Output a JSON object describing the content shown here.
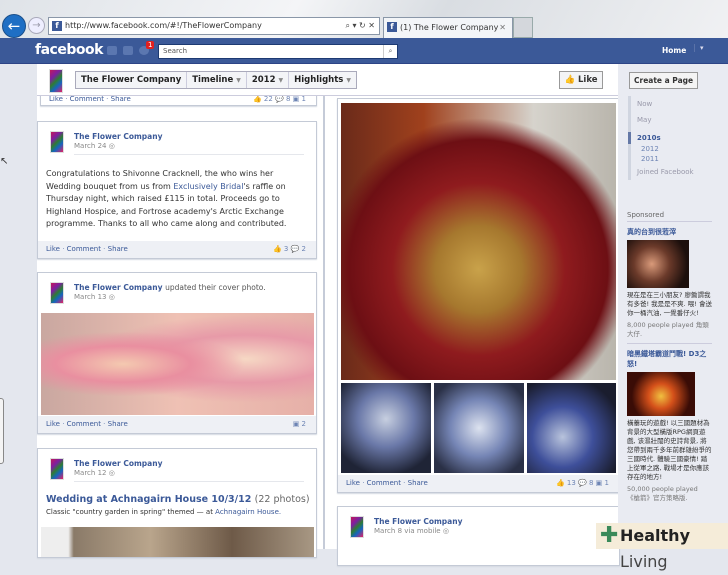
{
  "browser": {
    "url": "http://www.facebook.com/#!/TheFlowerCompany",
    "tab_title": "(1) The Flower Company",
    "addr_tools": "⌕ ▾ ↻ ✕",
    "tab_close": "✕",
    "back": "←",
    "forward": "→"
  },
  "fb": {
    "logo": "facebook",
    "notification_count": "1",
    "search_placeholder": "Search",
    "home": "Home",
    "home_dropdown": "▾"
  },
  "header": {
    "page_name": "The Flower Company",
    "timeline": "Timeline",
    "year": "2012",
    "highlights": "Highlights",
    "like_button": "Like"
  },
  "actions": {
    "like": "Like",
    "comment": "Comment",
    "share": "Share",
    "sep": " · "
  },
  "posts": [
    {
      "counts": {
        "likes": "22",
        "comments": "8",
        "shares": "1"
      }
    },
    {
      "name": "The Flower Company",
      "date": "March 24",
      "text_before": "Congratulations to Shivonne Cracknell, the who wins her Wedding bouquet from us from ",
      "link": "Exclusively Bridal",
      "text_after": "'s raffle on Thursday night, which raised £115 in total. Proceeds go to Highland Hospice, and Fortrose academy's Arctic Exchange programme. Thanks to all who came along and contributed.",
      "counts": {
        "likes": "3",
        "comments": "2"
      }
    },
    {
      "name": "The Flower Company",
      "action": "updated their cover photo.",
      "date": "March 13",
      "counts": {
        "shares": "2"
      }
    },
    {
      "name": "The Flower Company",
      "date": "March 12",
      "album_title": "Wedding at Achnagairn House 10/3/12",
      "photo_count": "(22 photos)",
      "caption": "Classic \"country garden in spring\" themed — at ",
      "location": "Achnagairn House."
    },
    {
      "counts": {
        "likes": "13",
        "comments": "8",
        "shares": "1"
      }
    },
    {
      "name": "The Flower Company",
      "date": "March 8 via mobile"
    }
  ],
  "sidebar": {
    "create_page": "Create a Page",
    "scrubber": [
      "Now",
      "May",
      "2010s",
      "2012",
      "2011",
      "Joined Facebook"
    ],
    "sponsored": "Sponsored",
    "ads": [
      {
        "title": "真的台到很蒞滓",
        "text": "現在是在三小朋友? 廖鋤謂我有多爸! 我是是不爽. 喂! 會送你一桶汽油, 一覺番仔火!",
        "meta": "8,000 people played 角頭大仔."
      },
      {
        "title": "暗黑鐵塔霸道鬥戰! D3之怒!",
        "text": "橫蓁玩的遊戲! 以三國題材為背景的大型橫版RPG網頁遊戲, 该濕壯闊的史詩背景, 將您帶到兩千多年前群雄紛爭的三國時代. 體驗三國豪情! 踏上從軍之路, 戰場才是你應該存在的地方!",
        "meta": "50,000 people played 《槍箭》官方策略版."
      }
    ]
  },
  "watermark": {
    "brand_bold": "Healthy",
    "brand_light": "Living"
  }
}
